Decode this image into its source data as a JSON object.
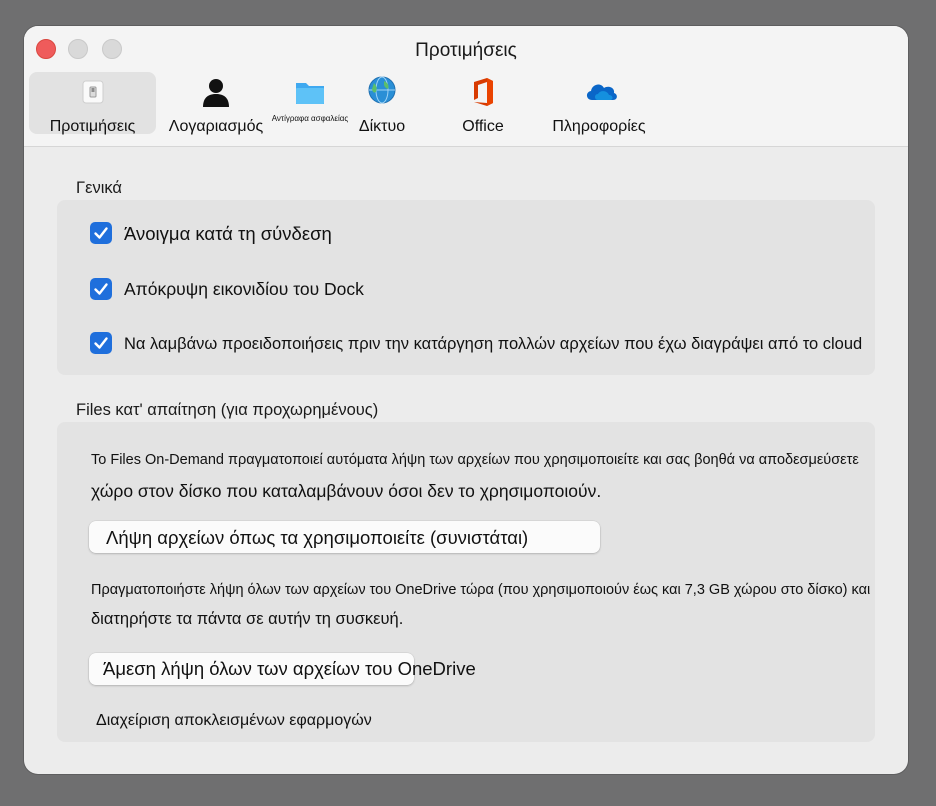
{
  "window": {
    "title": "Προτιμήσεις"
  },
  "tabs": [
    {
      "label": "Προτιμήσεις",
      "icon": "preferences-switch-icon",
      "active": true
    },
    {
      "label": "Λογαριασμός",
      "icon": "person-icon"
    },
    {
      "label": "Αντίγραφα ασφαλείας",
      "icon": "folder-icon"
    },
    {
      "label": "Δίκτυο",
      "icon": "globe-icon"
    },
    {
      "label": "Office",
      "icon": "office-logo-icon"
    },
    {
      "label": "Πληροφορίες",
      "icon": "onedrive-cloud-icon"
    }
  ],
  "general": {
    "title": "Γενικά",
    "options": [
      {
        "label": "Άνοιγμα κατά τη σύνδεση",
        "checked": true
      },
      {
        "label": "Απόκρυψη εικονιδίου του Dock",
        "checked": true
      },
      {
        "label": "Να λαμβάνω προειδοποιήσεις πριν την κατάργηση πολλών αρχείων που έχω διαγράψει από το cloud",
        "checked": true
      }
    ]
  },
  "files_on_demand": {
    "title": "Files κατ' απαίτηση (για προχωρημένους)",
    "desc1_line1": "Το Files On-Demand πραγματοποιεί αυτόματα λήψη των αρχείων που χρησιμοποιείτε και σας βοηθά να αποδεσμεύσετε",
    "desc1_line2": "χώρο στον δίσκο που καταλαμβάνουν όσοι δεν το χρησιμοποιούν.",
    "button1": "Λήψη αρχείων όπως τα χρησιμοποιείτε (συνιστάται)",
    "desc2_line1": "Πραγματοποιήστε λήψη όλων των αρχείων του OneDrive τώρα (που χρησιμοποιούν έως και 7,3 GB χώρου στο δίσκο) και",
    "desc2_line2": "διατηρήστε τα πάντα σε αυτήν τη συσκευή.",
    "button2": "Άμεση λήψη όλων των αρχείων του OneDrive",
    "link": "Διαχείριση αποκλεισμένων εφαρμογών"
  },
  "colors": {
    "checkbox": "#1f6fdc",
    "close": "#ef5b5b",
    "office": "#d83b01",
    "onedrive": "#0a66c8"
  }
}
